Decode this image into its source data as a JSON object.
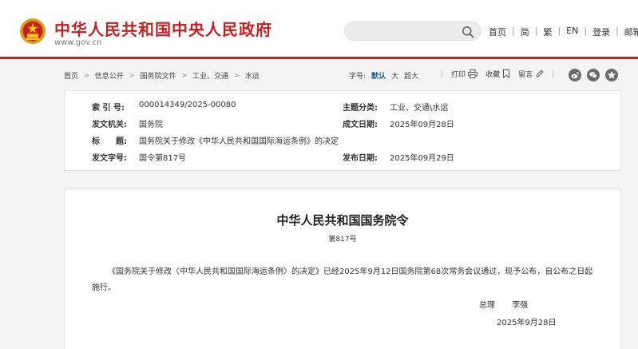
{
  "header": {
    "site_title": "中华人民共和国中央人民政府",
    "site_url": "www.gov.cn",
    "search_placeholder": "",
    "nav": [
      "首页",
      "简",
      "繁",
      "EN",
      "登录",
      "邮箱"
    ],
    "accent_color": "#c91f1f"
  },
  "breadcrumb": {
    "items": [
      "首页",
      "信息公开",
      "国务院文件",
      "工业、交通",
      "水运"
    ]
  },
  "font_size": {
    "label": "字号:",
    "options": [
      "默认",
      "大",
      "超大"
    ],
    "selected": "默认"
  },
  "tools": {
    "print": "打印",
    "favorite": "收藏",
    "message": "留言"
  },
  "share_icons": [
    "weibo-icon",
    "wechat-icon",
    "star-icon"
  ],
  "info": {
    "index_label": "索 引 号:",
    "index_value": "000014349/2025-00080",
    "category_label": "主题分类:",
    "category_value": "工业、交通\\水运",
    "issuer_label": "发文机关:",
    "issuer_value": "国务院",
    "written_label": "成文日期:",
    "written_value": "2025年09月28日",
    "title_label": "标　　题:",
    "title_value": "国务院关于修改《中华人民共和国国际海运条例》的决定",
    "docno_label": "发文字号:",
    "docno_value": "国令第817号",
    "published_label": "发布日期:",
    "published_value": "2025年09月29日"
  },
  "document": {
    "title": "中华人民共和国国务院令",
    "number": "第817号",
    "body": "《国务院关于修改〈中华人民共和国国际海运条例〉的决定》已经2025年9月12日国务院第68次常务会议通过，现予公布，自公布之日起施行。",
    "sign_role": "总理",
    "sign_name": "李强",
    "date": "2025年9月28日"
  }
}
